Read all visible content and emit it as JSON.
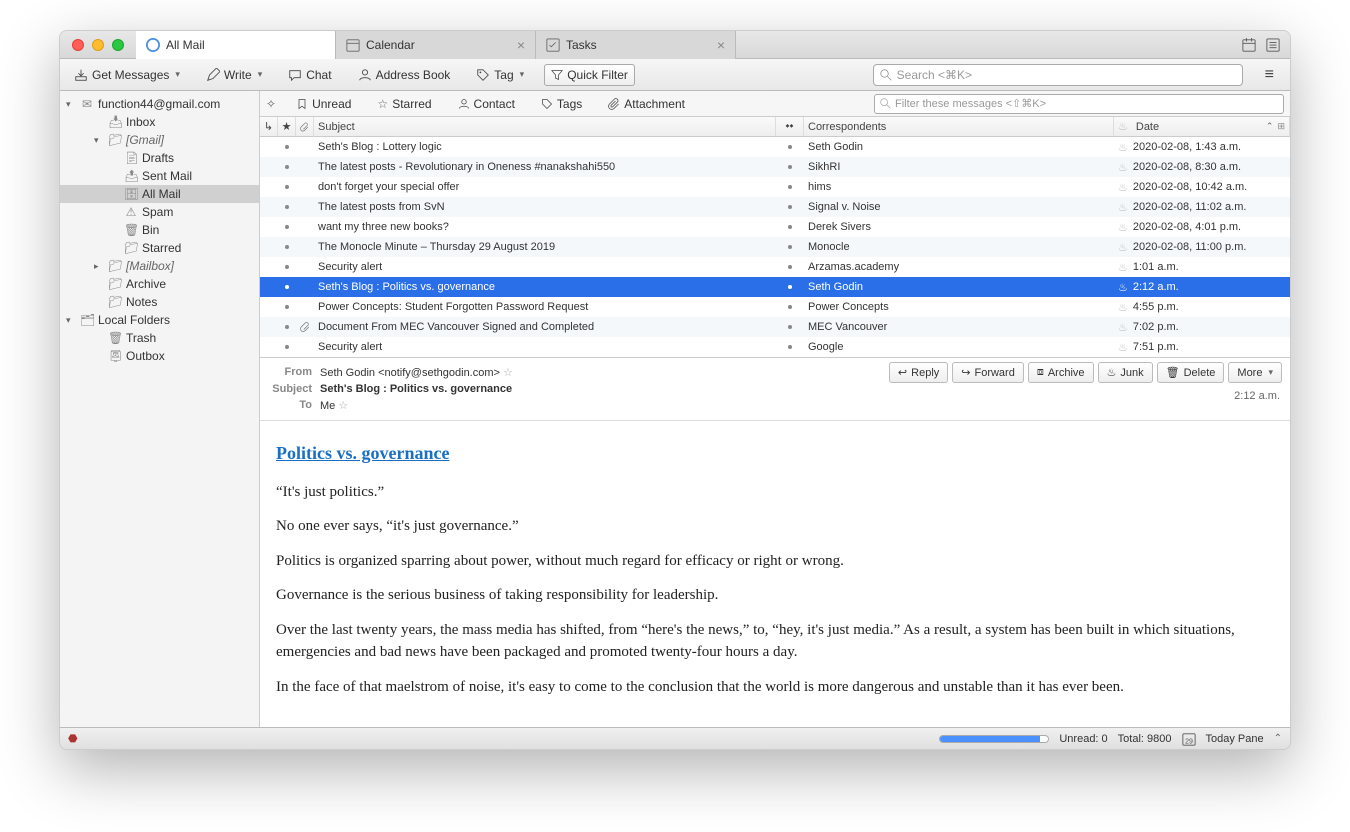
{
  "tabs": [
    {
      "label": "All Mail",
      "active": true,
      "closable": false
    },
    {
      "label": "Calendar",
      "active": false,
      "closable": true
    },
    {
      "label": "Tasks",
      "active": false,
      "closable": true
    }
  ],
  "toolbar": {
    "get_messages": "Get Messages",
    "write": "Write",
    "chat": "Chat",
    "address_book": "Address Book",
    "tag": "Tag",
    "quick_filter": "Quick Filter",
    "search_placeholder": "Search <⌘K>"
  },
  "sidebar": {
    "account": "function44@gmail.com",
    "items": [
      {
        "label": "Inbox",
        "indent": 2,
        "icon": "inbox"
      },
      {
        "label": "[Gmail]",
        "indent": 2,
        "icon": "folder",
        "expand": "open",
        "italic": true
      },
      {
        "label": "Drafts",
        "indent": 3,
        "icon": "drafts"
      },
      {
        "label": "Sent Mail",
        "indent": 3,
        "icon": "sent"
      },
      {
        "label": "All Mail",
        "indent": 3,
        "icon": "allmail",
        "selected": true
      },
      {
        "label": "Spam",
        "indent": 3,
        "icon": "spam"
      },
      {
        "label": "Bin",
        "indent": 3,
        "icon": "trash"
      },
      {
        "label": "Starred",
        "indent": 3,
        "icon": "folder"
      },
      {
        "label": "[Mailbox]",
        "indent": 2,
        "icon": "folder",
        "expand": "closed",
        "italic": true
      },
      {
        "label": "Archive",
        "indent": 2,
        "icon": "folder"
      },
      {
        "label": "Notes",
        "indent": 2,
        "icon": "folder"
      }
    ],
    "local_folders": "Local Folders",
    "local_items": [
      {
        "label": "Trash",
        "icon": "trash"
      },
      {
        "label": "Outbox",
        "icon": "outbox"
      }
    ]
  },
  "filterbar": {
    "unread": "Unread",
    "starred": "Starred",
    "contact": "Contact",
    "tags": "Tags",
    "attachment": "Attachment",
    "filter_placeholder": "Filter these messages <⇧⌘K>"
  },
  "columns": {
    "subject": "Subject",
    "correspondents": "Correspondents",
    "date": "Date"
  },
  "messages": [
    {
      "subject": "Seth's Blog : Lottery logic",
      "corr": "Seth Godin",
      "date": "2020-02-08, 1:43 a.m."
    },
    {
      "subject": "The latest posts - Revolutionary in Oneness #nanakshahi550",
      "corr": "SikhRI",
      "date": "2020-02-08, 8:30 a.m."
    },
    {
      "subject": "don't forget your special offer",
      "corr": "hims",
      "date": "2020-02-08, 10:42 a.m."
    },
    {
      "subject": "The latest posts from SvN",
      "corr": "Signal v. Noise",
      "date": "2020-02-08, 11:02 a.m."
    },
    {
      "subject": "want my three new books?",
      "corr": "Derek Sivers",
      "date": "2020-02-08, 4:01 p.m."
    },
    {
      "subject": "The Monocle Minute – Thursday 29 August 2019",
      "corr": "Monocle",
      "date": "2020-02-08, 11:00 p.m."
    },
    {
      "subject": "Security alert",
      "corr": "Arzamas.academy",
      "date": "1:01 a.m."
    },
    {
      "subject": "Seth's Blog : Politics vs. governance",
      "corr": "Seth Godin",
      "date": "2:12 a.m.",
      "selected": true
    },
    {
      "subject": "Power Concepts: Student Forgotten Password Request",
      "corr": "Power Concepts",
      "date": "4:55 p.m."
    },
    {
      "subject": "Document From MEC Vancouver Signed and Completed",
      "corr": "MEC Vancouver",
      "date": "7:02 p.m.",
      "attach": true
    },
    {
      "subject": "Security alert",
      "corr": "Google",
      "date": "7:51 p.m."
    }
  ],
  "preview": {
    "from_label": "From",
    "from": "Seth Godin <notify@sethgodin.com>",
    "subject_label": "Subject",
    "subject": "Seth's Blog : Politics vs. governance",
    "to_label": "To",
    "to": "Me",
    "time": "2:12 a.m.",
    "actions": {
      "reply": "Reply",
      "forward": "Forward",
      "archive": "Archive",
      "junk": "Junk",
      "delete": "Delete",
      "more": "More"
    },
    "title": "Politics vs. governance",
    "paras": [
      "“It's just politics.”",
      "No one ever says, “it's just governance.”",
      "Politics is organized sparring about power, without much regard for efficacy or right or wrong.",
      "Governance is the serious business of taking responsibility for leadership.",
      "Over the last twenty years, the mass media has shifted, from “here's the news,” to, “hey, it's just media.” As a result, a system has been built in which situations, emergencies and bad news have been packaged and promoted twenty-four hours a day.",
      "In the face of that maelstrom of noise, it's easy to come to the conclusion that the world is more dangerous and unstable than it has ever been."
    ]
  },
  "statusbar": {
    "unread": "Unread: 0",
    "total": "Total: 9800",
    "today_pane": "Today Pane"
  }
}
